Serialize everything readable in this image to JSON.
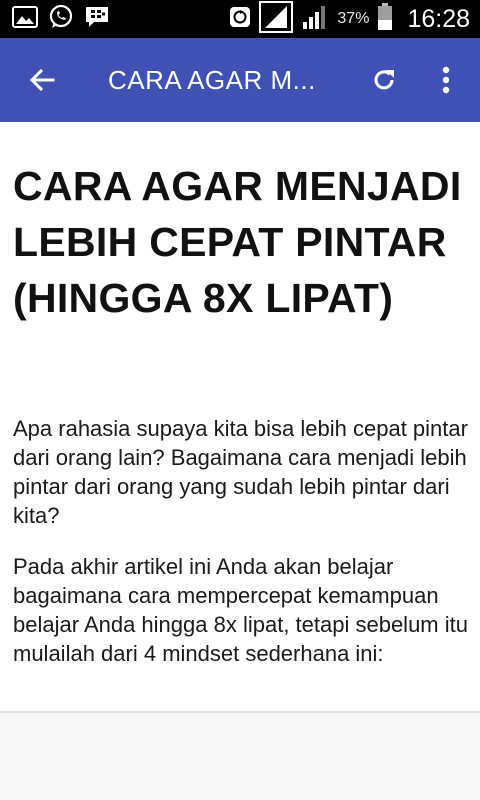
{
  "status_bar": {
    "battery_percent": "37%",
    "time": "16:28",
    "icons": [
      "gallery-icon",
      "whatsapp-icon",
      "bbm-icon",
      "sync-icon",
      "signal-icon",
      "signal-icon-2",
      "battery-icon"
    ]
  },
  "app_bar": {
    "title": "CARA AGAR M...",
    "color": "#3f51b5"
  },
  "article": {
    "title": "CARA AGAR MENJADI LEBIH CEPAT PINTAR (HINGGA 8X LIPAT)",
    "paragraphs": [
      "Apa rahasia supaya kita bisa lebih cepat pintar dari orang lain? Bagaimana cara menjadi lebih pintar dari orang yang sudah lebih pintar dari kita?",
      "Pada akhir artikel ini Anda akan belajar bagaimana cara mempercepat kemampuan belajar Anda hingga 8x lipat, tetapi sebelum itu mulailah dari 4 mindset sederhana ini:"
    ]
  }
}
